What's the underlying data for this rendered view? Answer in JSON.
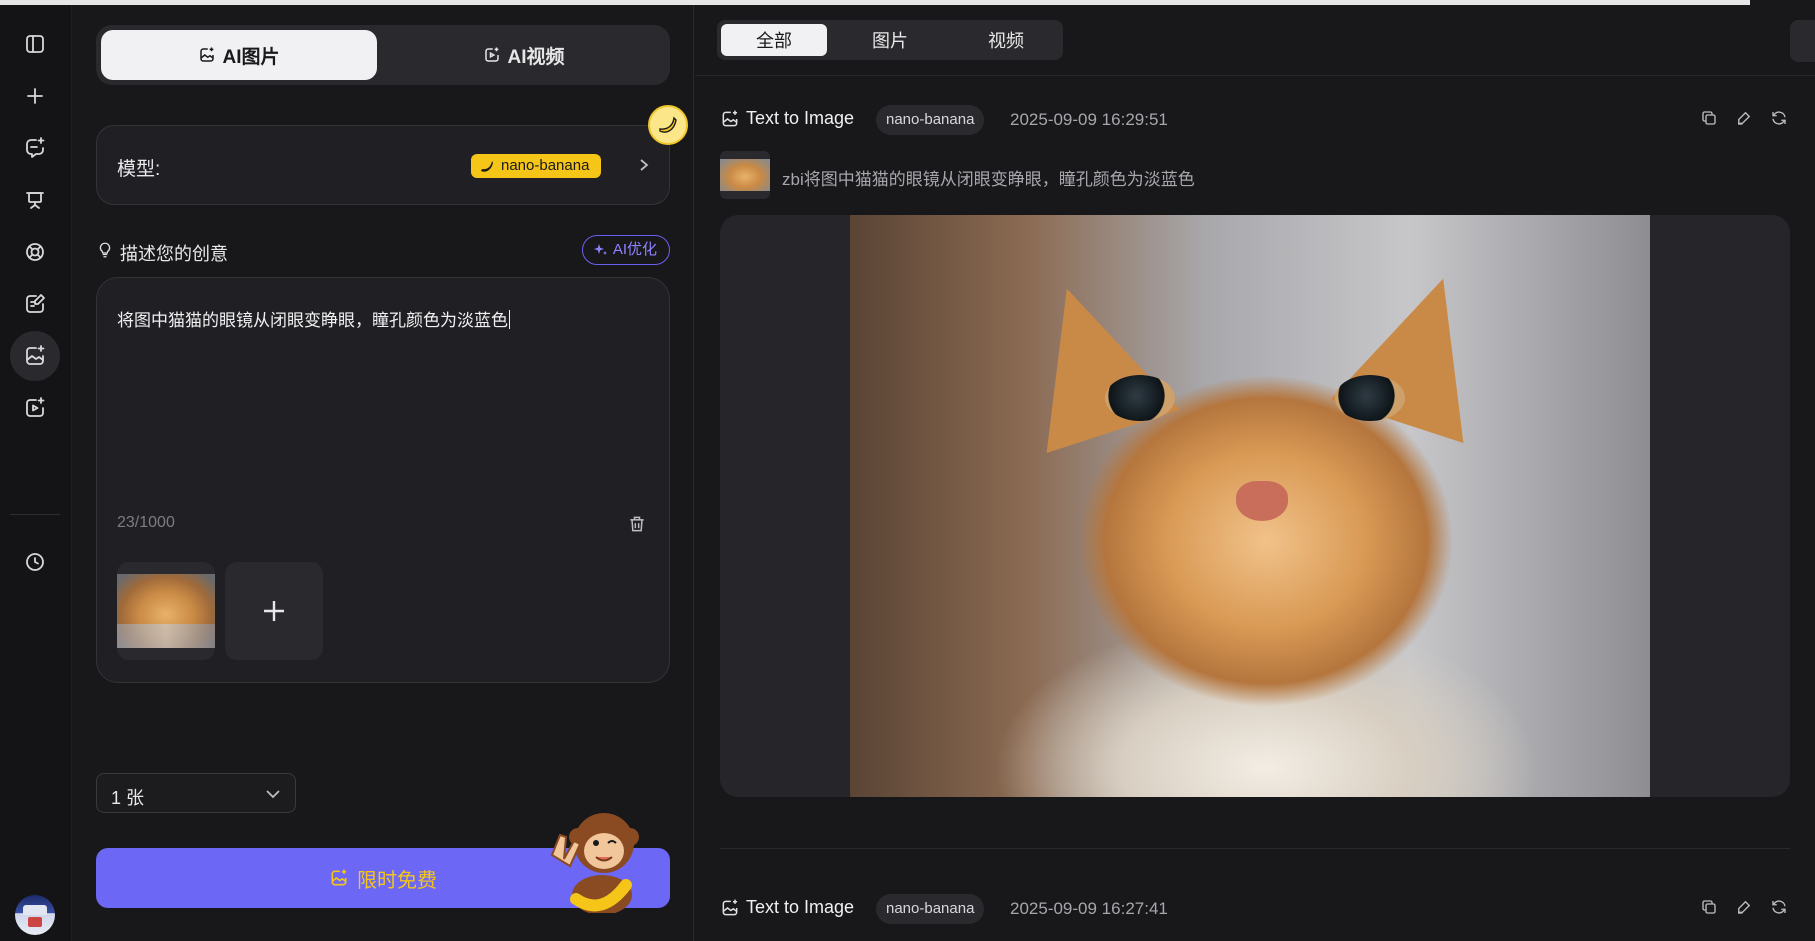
{
  "sidebar": {
    "icons": [
      "sidebar-toggle-icon",
      "plus-icon",
      "chat-sparkle-icon",
      "easel-icon",
      "lifebuoy-icon",
      "edit-note-icon",
      "image-sparkle-icon",
      "video-sparkle-icon",
      "history-clock-icon"
    ]
  },
  "panel": {
    "tabs": [
      {
        "label": "AI图片",
        "active": true
      },
      {
        "label": "AI视频",
        "active": false
      }
    ],
    "model_label": "模型:",
    "model_value": "nano-banana",
    "describe_title": "描述您的创意",
    "ai_optimize_label": "AI优化",
    "prompt_text": "将图中猫猫的眼镜从闭眼变睁眼，瞳孔颜色为淡蓝色",
    "char_count": "23/1000",
    "count_value": "1 张",
    "generate_label": "限时免费"
  },
  "main": {
    "filters": [
      {
        "label": "全部",
        "active": true
      },
      {
        "label": "图片",
        "active": false
      },
      {
        "label": "视频",
        "active": false
      }
    ],
    "records": [
      {
        "type": "Text to Image",
        "model": "nano-banana",
        "time": "2025-09-09 16:29:51",
        "prompt": "zbi将图中猫猫的眼镜从闭眼变睁眼，瞳孔颜色为淡蓝色"
      },
      {
        "type": "Text to Image",
        "model": "nano-banana",
        "time": "2025-09-09 16:27:41"
      }
    ]
  },
  "colors": {
    "accent": "#6c67f5",
    "badge_yellow": "#f5c518",
    "ai_purple": "#8c82ff",
    "background": "#18181b"
  }
}
